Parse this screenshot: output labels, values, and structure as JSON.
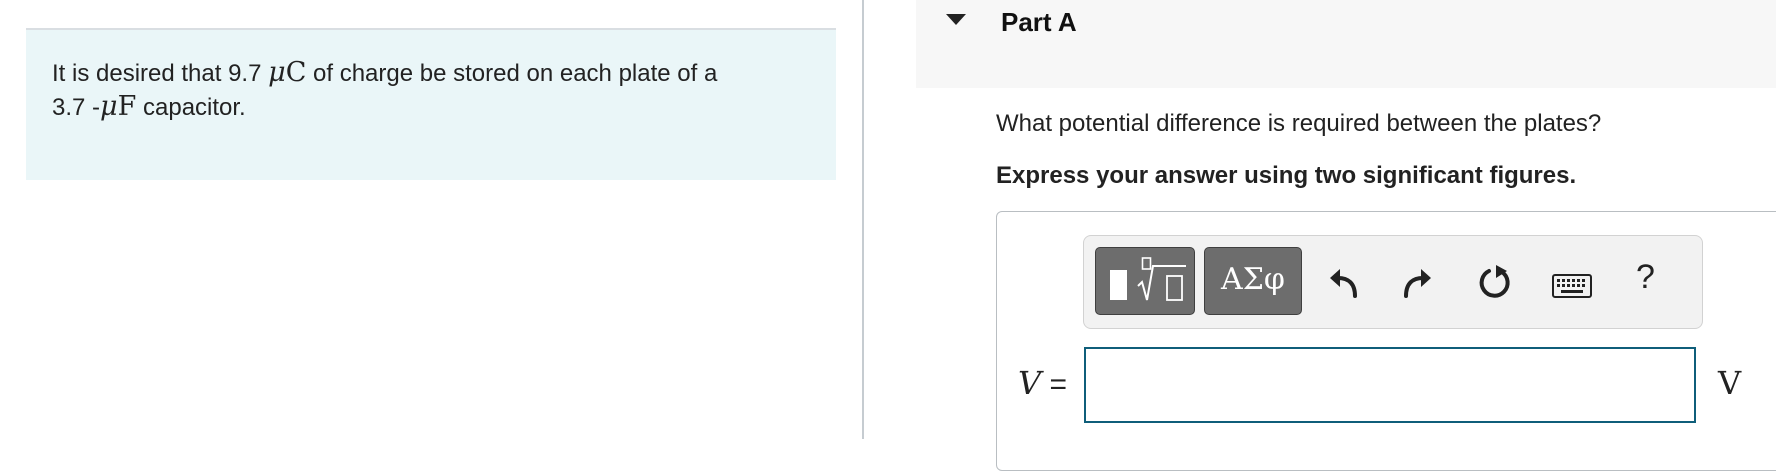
{
  "problem": {
    "text_1": "It is desired that 9.7 ",
    "charge_unit_mu": "μ",
    "charge_unit_letter": "C",
    "text_2": " of charge be stored on each plate of a",
    "text_3": "3.7 -",
    "cap_unit_mu": "μ",
    "cap_unit_letter": "F",
    "text_4": " capacitor."
  },
  "part": {
    "title": "Part A"
  },
  "question": "What potential difference is required between the plates?",
  "instruction": "Express your answer using two significant figures.",
  "toolbar": {
    "greek_label": "ΑΣφ",
    "help_label": "?"
  },
  "answer": {
    "variable": "V",
    "equals": " =",
    "value": "",
    "unit": "V"
  },
  "colors": {
    "problem_bg": "#eaf6f8",
    "input_border": "#0f5e7a",
    "tool_button": "#6d6d6d"
  }
}
